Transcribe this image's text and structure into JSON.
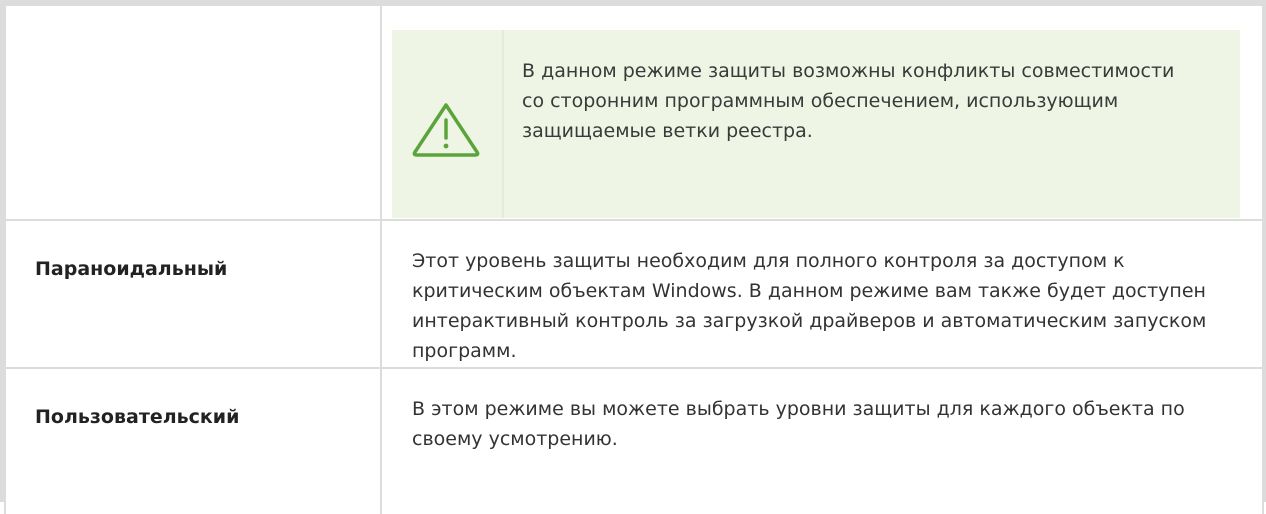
{
  "notice": {
    "icon": "warning-triangle-icon",
    "accent": "#5aa43c",
    "background": "#eef5e4",
    "text": "В данном режиме защиты возможны конфликты совместимости со сторонним программным обеспечением, использующим защищаемые ветки реестра."
  },
  "modes": [
    {
      "name": "Параноидальный",
      "description": "Этот уровень защиты необходим для полного контроля за доступом к критическим объектам Windows. В данном режиме вам также будет доступен интерактивный контроль за загрузкой драйверов и автоматическим запуском программ."
    },
    {
      "name": "Пользовательский",
      "description": "В этом режиме вы можете выбрать уровни защиты для каждого объекта по своему усмотрению."
    }
  ]
}
